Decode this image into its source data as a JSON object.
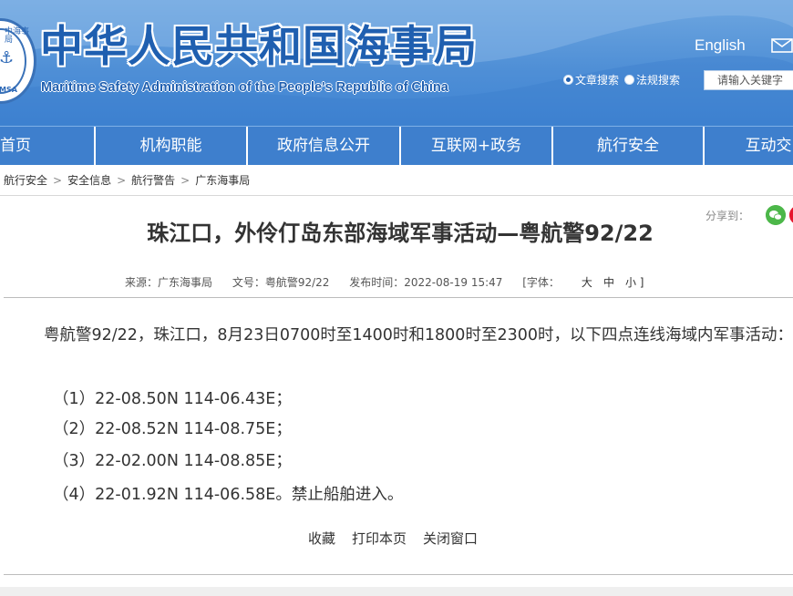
{
  "header": {
    "logo_text_top": "中海事局",
    "logo_text_bottom": "MSA",
    "title": "中华人民共和国海事局",
    "subtitle": "Maritime Safety Administration of the People's Republic of China",
    "english_link": "English",
    "search_options": [
      {
        "label": "文章搜索",
        "selected": true
      },
      {
        "label": "法规搜索",
        "selected": false
      }
    ],
    "search_placeholder": "请输入关键字"
  },
  "nav": {
    "items": [
      "首页",
      "机构职能",
      "政府信息公开",
      "互联网+政务",
      "航行安全",
      "互动交"
    ]
  },
  "breadcrumb": [
    "航行安全",
    "安全信息",
    "航行警告",
    "广东海事局"
  ],
  "share": {
    "label": "分享到：",
    "icons": [
      "wechat-icon",
      "weibo-icon"
    ]
  },
  "article": {
    "title": "珠江口，外伶仃岛东部海域军事活动—粤航警92/22",
    "meta": {
      "source": "来源：广东海事局",
      "doc_no": "文号：粤航警92/22",
      "published": "发布时间：2022-08-19 15:47",
      "font_label": "[字体：",
      "font_large": "大",
      "font_medium": "中",
      "font_small": "小 ]"
    },
    "paragraph": "粤航警92/22，珠江口，8月23日0700时至1400时和1800时至2300时，以下四点连线海域内军事活动：",
    "coordinates": [
      "（1）22-08.50N 114-06.43E；",
      "（2）22-08.52N 114-08.75E；",
      "（3）22-02.00N 114-08.85E；",
      "（4）22-01.92N 114-06.58E。禁止船舶进入。"
    ]
  },
  "actions": {
    "favorite": "收藏",
    "print": "打印本页",
    "close": "关闭窗口"
  },
  "colors": {
    "header_blue": "#4f8fd6",
    "nav_blue": "#3e7fcd",
    "title_blue": "#1f5fb0"
  }
}
